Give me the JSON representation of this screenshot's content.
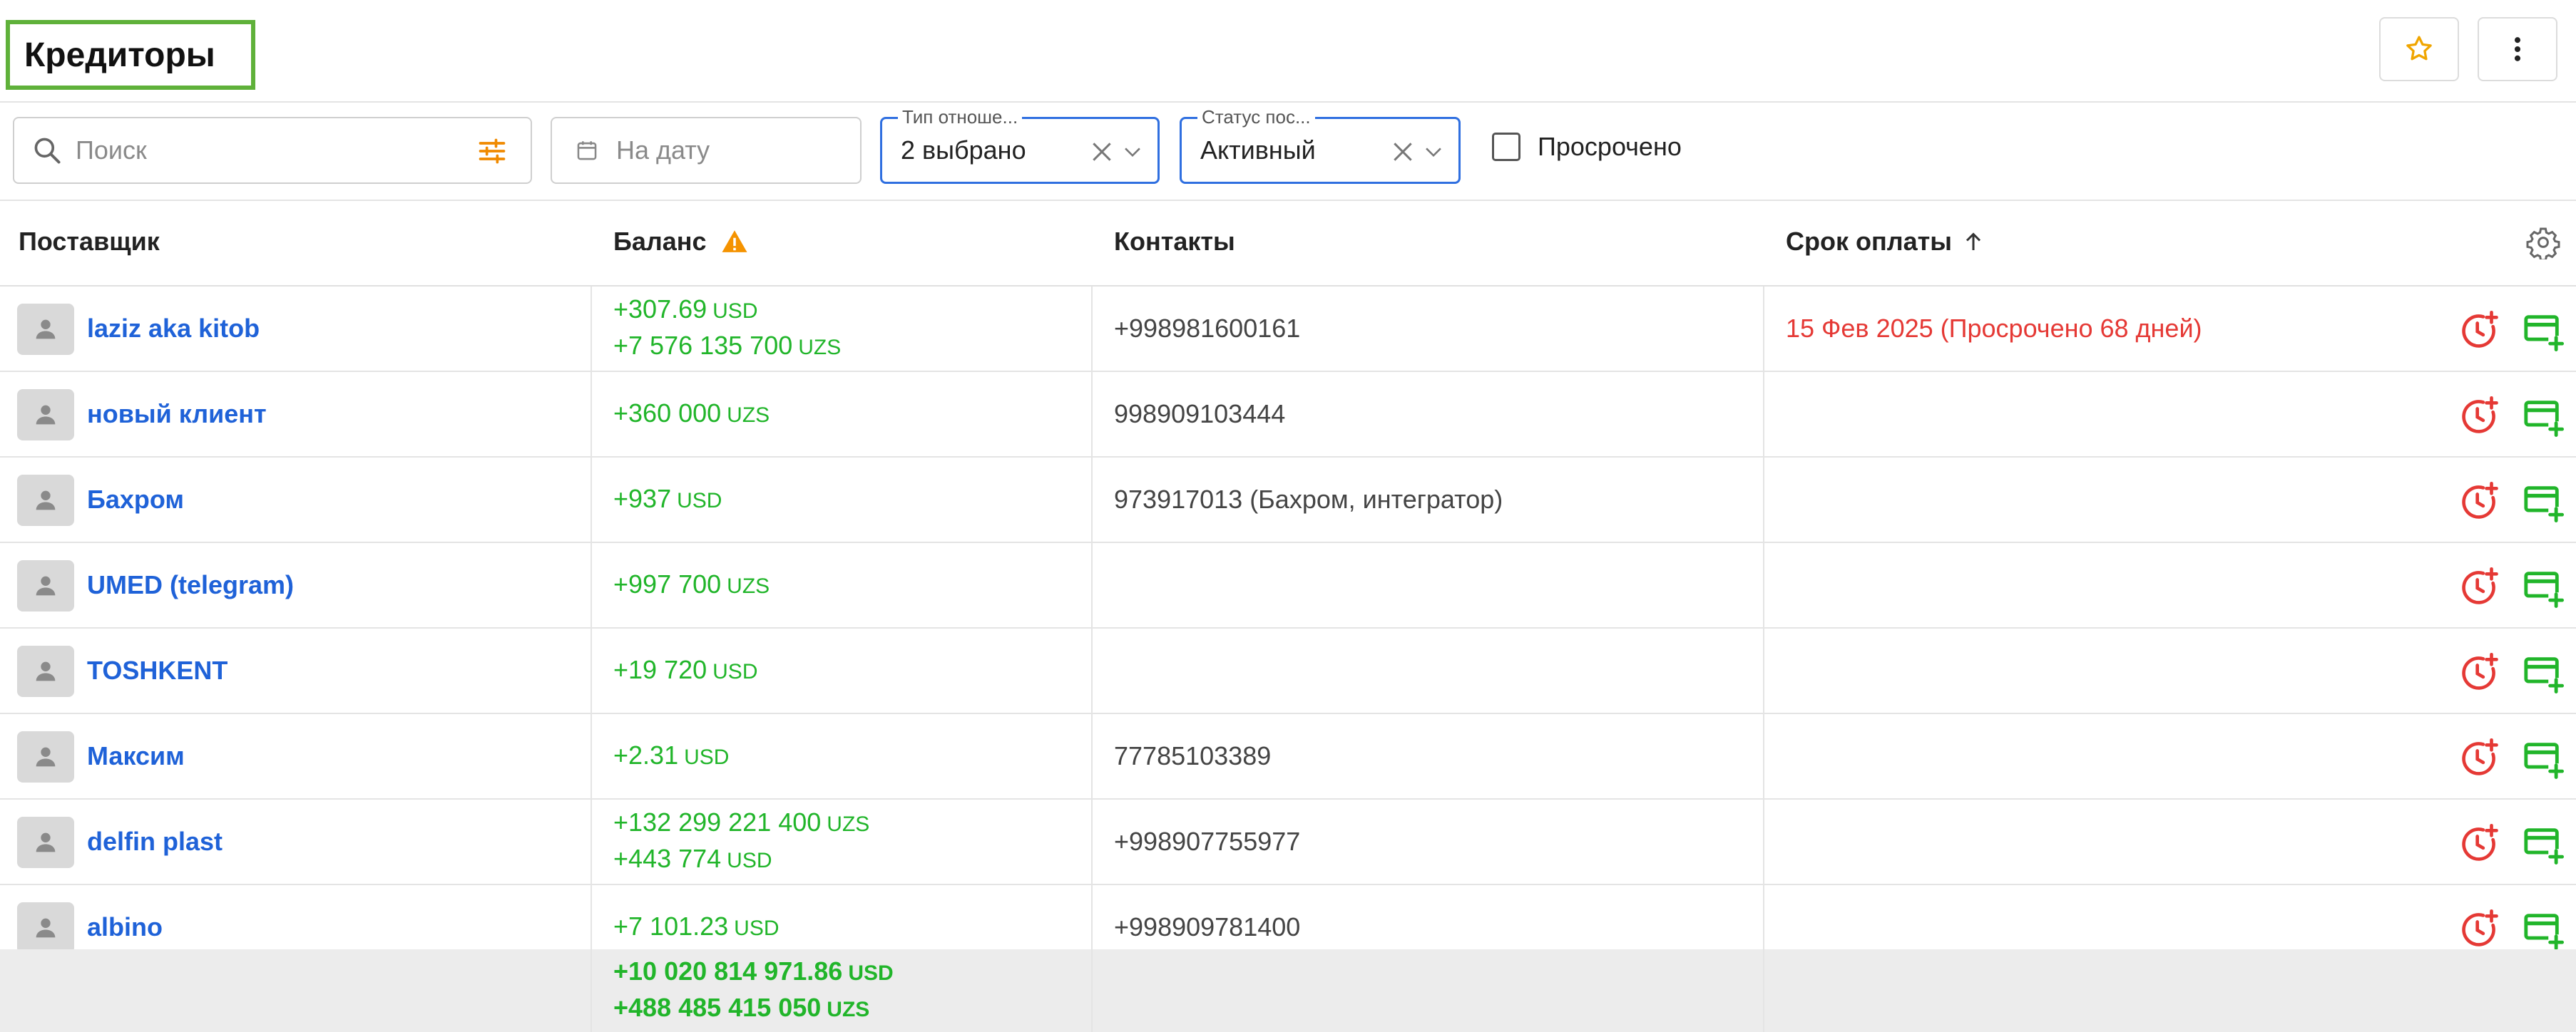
{
  "header": {
    "title": "Кредиторы",
    "favorite_icon": "star-icon",
    "more_icon": "more-vertical-icon"
  },
  "filters": {
    "search_placeholder": "Поиск",
    "date_placeholder": "На дату",
    "relation_type_label": "Тип отноше...",
    "relation_type_value": "2 выбрано",
    "status_label": "Статус пос...",
    "status_value": "Активный",
    "overdue_label": "Просрочено",
    "overdue_checked": false
  },
  "table": {
    "columns": {
      "supplier": "Поставщик",
      "balance": "Баланс",
      "contacts": "Контакты",
      "due": "Срок оплаты"
    },
    "rows": [
      {
        "name": "laziz aka kitob",
        "balances": [
          {
            "amount": "+307.69",
            "currency": "USD"
          },
          {
            "amount": "+7 576 135 700",
            "currency": "UZS"
          }
        ],
        "contact": "+998981600161",
        "due": "15 Фев 2025 (Просрочено 68 дней)"
      },
      {
        "name": "новый клиент",
        "balances": [
          {
            "amount": "+360 000",
            "currency": "UZS"
          }
        ],
        "contact": "998909103444",
        "due": ""
      },
      {
        "name": "Бахром",
        "balances": [
          {
            "amount": "+937",
            "currency": "USD"
          }
        ],
        "contact": "973917013 (Бахром, интегратор)",
        "due": ""
      },
      {
        "name": "UMED (telegram)",
        "balances": [
          {
            "amount": "+997 700",
            "currency": "UZS"
          }
        ],
        "contact": "",
        "due": ""
      },
      {
        "name": "TOSHKENT",
        "balances": [
          {
            "amount": "+19 720",
            "currency": "USD"
          }
        ],
        "contact": "",
        "due": ""
      },
      {
        "name": "Максим",
        "balances": [
          {
            "amount": "+2.31",
            "currency": "USD"
          }
        ],
        "contact": "77785103389",
        "due": ""
      },
      {
        "name": "delfin plast",
        "balances": [
          {
            "amount": "+132 299 221 400",
            "currency": "UZS"
          },
          {
            "amount": "+443 774",
            "currency": "USD"
          }
        ],
        "contact": "+998907755977",
        "due": ""
      },
      {
        "name": "albino",
        "balances": [
          {
            "amount": "+7 101.23",
            "currency": "USD"
          }
        ],
        "contact": "+998909781400",
        "due": ""
      }
    ],
    "totals": [
      {
        "amount": "+10 020 814 971.86",
        "currency": "USD"
      },
      {
        "amount": "+488 485 415 050",
        "currency": "UZS"
      }
    ]
  },
  "colors": {
    "accent_blue": "#1f62d8",
    "positive_green": "#21b52a",
    "overdue_red": "#e53935",
    "warning_orange": "#f59300",
    "highlight_green": "#5fb13a"
  }
}
